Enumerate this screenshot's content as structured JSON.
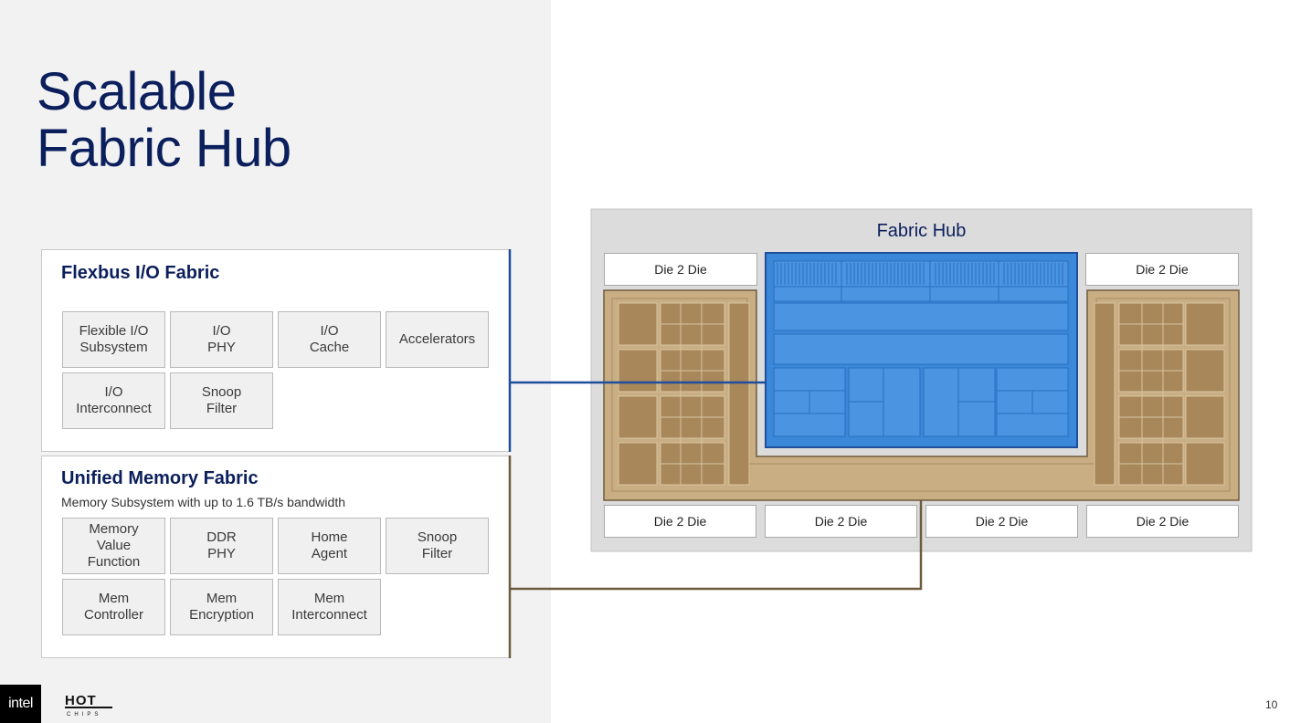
{
  "title": {
    "line1": "Scalable",
    "line2": "Fabric Hub"
  },
  "flexbus": {
    "title": "Flexbus I/O Fabric",
    "cells": [
      "Flexible I/O\nSubsystem",
      "I/O\nPHY",
      "I/O\nCache",
      "Accelerators",
      "I/O\nInterconnect",
      "Snoop\nFilter"
    ]
  },
  "umf": {
    "title": "Unified Memory Fabric",
    "subtitle": "Memory Subsystem with up to 1.6 TB/s bandwidth",
    "cells": [
      "Memory\nValue\nFunction",
      "DDR\nPHY",
      "Home\nAgent",
      "Snoop\nFilter",
      "Mem\nController",
      "Mem\nEncryption",
      "Mem\nInterconnect"
    ]
  },
  "hub": {
    "title": "Fabric Hub",
    "die_top_left": "Die 2 Die",
    "die_top_right": "Die 2 Die",
    "die_bottom": [
      "Die 2 Die",
      "Die 2 Die",
      "Die 2 Die",
      "Die 2 Die"
    ]
  },
  "colors": {
    "title_navy": "#0b1f5c",
    "flexbus_line": "#1f4e9c",
    "memory_line": "#6e5a3c",
    "tan": "#c9ae84",
    "blue_block": "#3b87d8"
  },
  "logos": {
    "intel": "intel",
    "hotchips": "HOT CHIPS"
  },
  "page_number": "10"
}
